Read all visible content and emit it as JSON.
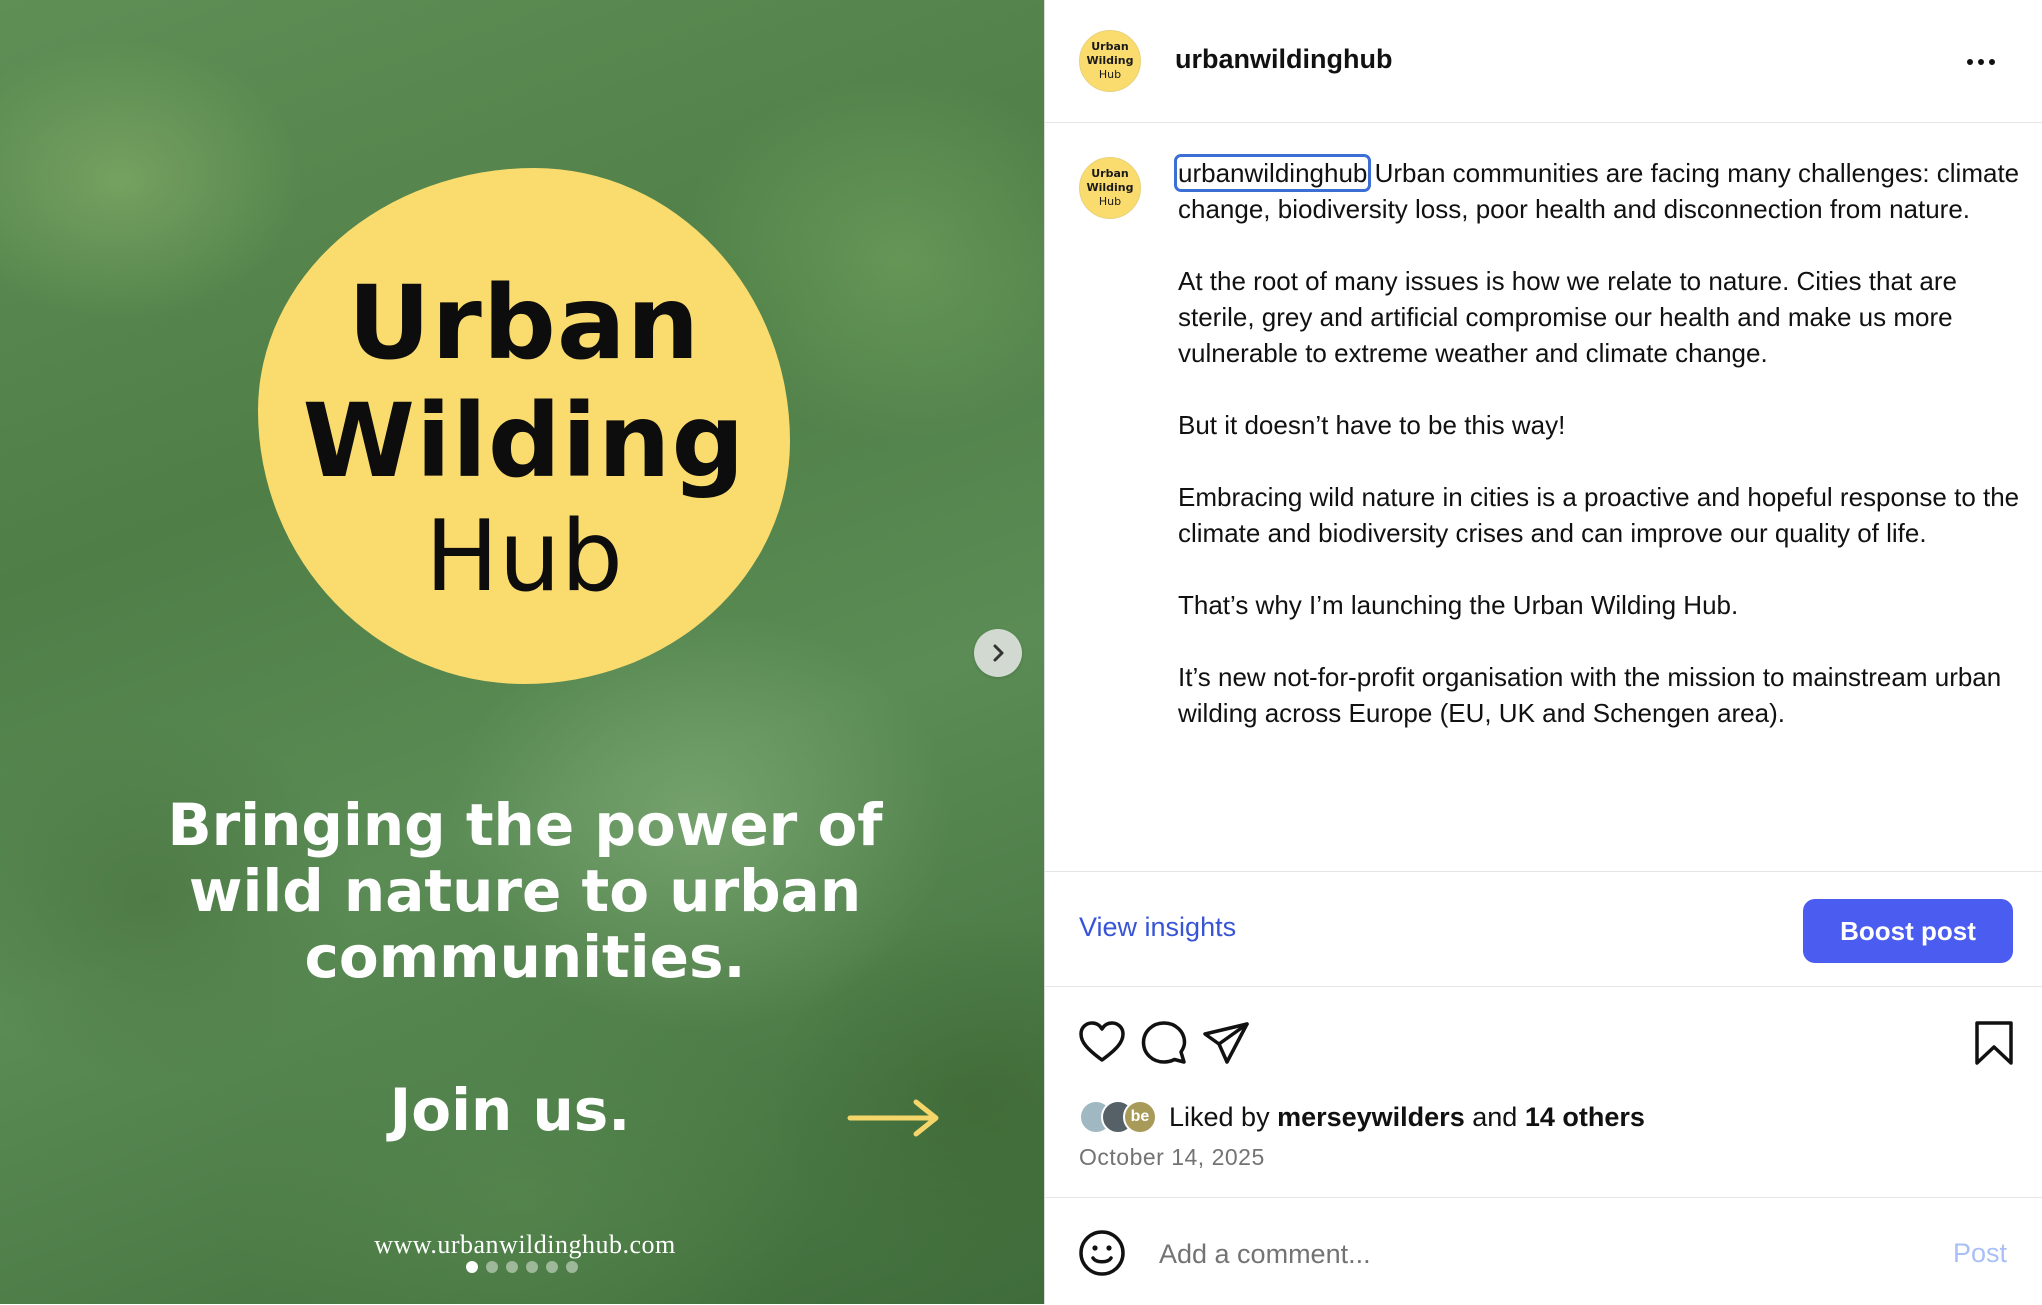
{
  "media": {
    "logo_lines": [
      "Urban",
      "Wilding",
      "Hub"
    ],
    "tagline": [
      "Bringing the power of",
      "wild nature to urban",
      "communities."
    ],
    "cta": "Join us.",
    "url": "www.urbanwildinghub.com",
    "slide_count": 6,
    "active_slide": 1,
    "next_icon": "chevron-right-icon"
  },
  "header": {
    "username": "urbanwildinghub",
    "avatar_lines": [
      "Urban",
      "Wilding",
      "Hub"
    ],
    "more_icon": "more-horizontal-icon"
  },
  "caption": {
    "username": "urbanwildinghub",
    "text": "Urban communities are facing many challenges: climate change, biodiversity loss, poor health and disconnection from nature.\n\nAt the root of many issues is how we relate to nature. Cities that are sterile, grey and artificial compromise our health and make us more vulnerable to extreme weather and climate change.\n\nBut it doesn’t have to be this way!\n\nEmbracing wild nature in cities is a proactive and hopeful response to the climate and biodiversity crises and can improve our quality of life.\n\nThat’s why I’m launching the Urban Wilding Hub.\n\nIt’s new not-for-profit organisation with the mission to mainstream urban wilding across Europe (EU, UK and Schengen area)."
  },
  "insights": {
    "view_label": "View insights",
    "boost_label": "Boost post"
  },
  "actions": {
    "icons": [
      "heart-icon",
      "comment-icon",
      "share-icon",
      "bookmark-icon"
    ]
  },
  "likes": {
    "prefix": "Liked by",
    "user": "merseywilders",
    "joiner": "and",
    "others": "14 others",
    "avatar_initials": "be"
  },
  "date": "October 14, 2025",
  "comment": {
    "placeholder": "Add a comment...",
    "post_label": "Post"
  },
  "colors": {
    "accent_blue": "#3854d6",
    "boost_bg": "#4a5df0",
    "logo_yellow": "#fadc6e",
    "post_disabled": "#a9bff5"
  }
}
